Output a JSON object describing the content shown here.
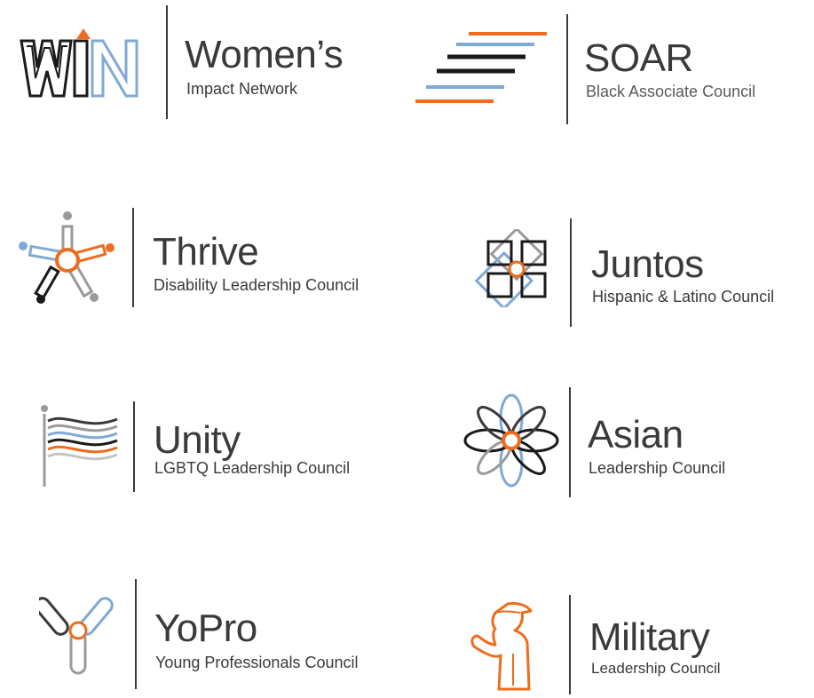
{
  "colors": {
    "orange": "#ee6c1d",
    "blue": "#7fa9d6",
    "black": "#1a1a1a",
    "gray": "#9a9a9a",
    "text": "#3a3a3c"
  },
  "logos": [
    {
      "icon": "win-icon",
      "title": "Women’s",
      "subtitle": "Impact Network"
    },
    {
      "icon": "soar-stripes-icon",
      "title": "SOAR",
      "subtitle": "Black Associate Council"
    },
    {
      "icon": "thrive-figure-icon",
      "title": "Thrive",
      "subtitle": "Disability Leadership Council"
    },
    {
      "icon": "juntos-squares-icon",
      "title": "Juntos",
      "subtitle": "Hispanic & Latino Council"
    },
    {
      "icon": "unity-flag-icon",
      "title": "Unity",
      "subtitle": "LGBTQ Leadership Council"
    },
    {
      "icon": "asian-flower-icon",
      "title": "Asian",
      "subtitle": "Leadership Council"
    },
    {
      "icon": "yopro-y-icon",
      "title": "YoPro",
      "subtitle": "Young Professionals Council"
    },
    {
      "icon": "military-salute-icon",
      "title": "Military",
      "subtitle": "Leadership Council"
    }
  ]
}
